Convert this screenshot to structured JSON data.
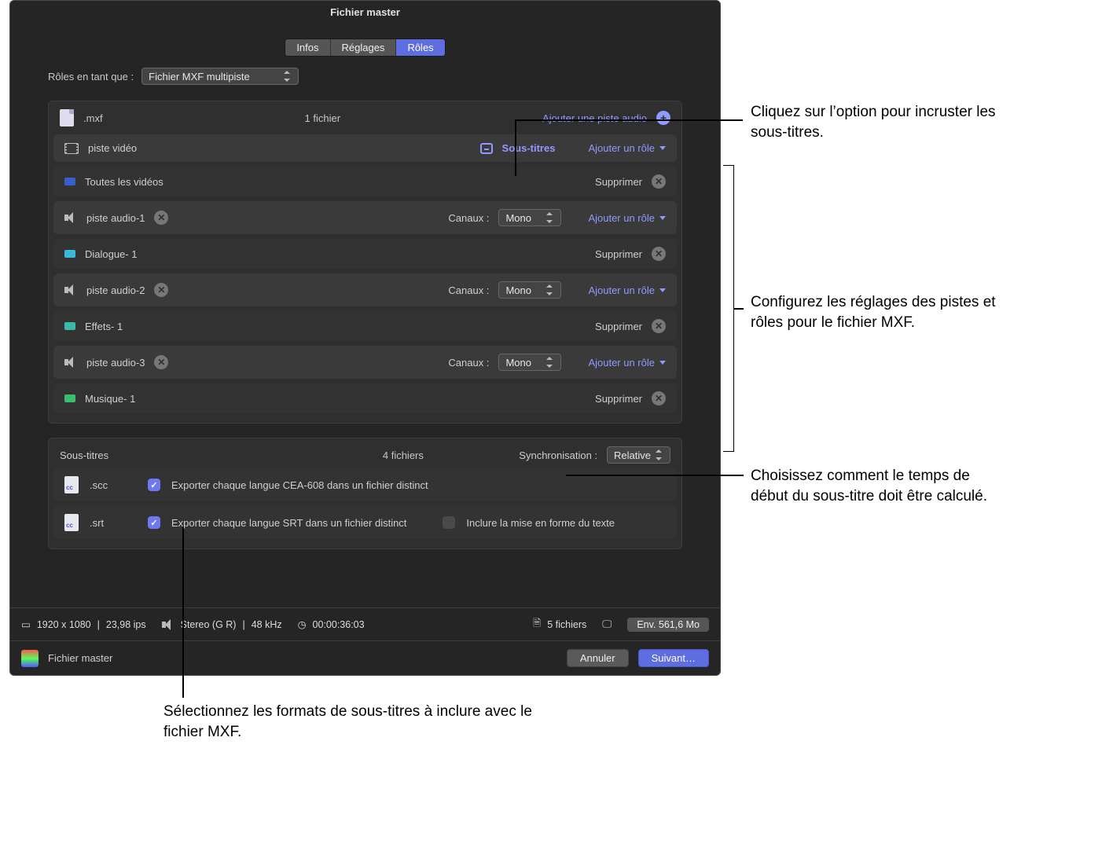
{
  "window_title": "Fichier master",
  "tabs": {
    "infos": "Infos",
    "reglages": "Réglages",
    "roles": "Rôles"
  },
  "roles_as": {
    "label": "Rôles en tant que :",
    "value": "Fichier MXF multipiste"
  },
  "mxf": {
    "ext": ".mxf",
    "count": "1 fichier",
    "add_audio": "Ajouter une piste audio",
    "video_track": {
      "label": "piste vidéo",
      "captions_btn": "Sous-titres",
      "add_role": "Ajouter un rôle",
      "sub": {
        "label": "Toutes les vidéos",
        "remove": "Supprimer"
      }
    },
    "channels_label": "Canaux :",
    "add_role": "Ajouter un rôle",
    "remove": "Supprimer",
    "audio": [
      {
        "name": "piste audio-1",
        "channel": "Mono",
        "sub": "Dialogue- 1",
        "chip": "cyan"
      },
      {
        "name": "piste audio-2",
        "channel": "Mono",
        "sub": "Effets- 1",
        "chip": "teal"
      },
      {
        "name": "piste audio-3",
        "channel": "Mono",
        "sub": "Musique- 1",
        "chip": "green"
      }
    ]
  },
  "captions": {
    "header": "Sous-titres",
    "count": "4 fichiers",
    "sync_label": "Synchronisation :",
    "sync_value": "Relative",
    "rows": [
      {
        "ext": ".scc",
        "export_label": "Exporter chaque langue CEA-608 dans un fichier distinct",
        "include_fmt": null
      },
      {
        "ext": ".srt",
        "export_label": "Exporter chaque langue SRT dans un fichier distinct",
        "include_fmt": "Inclure la mise en forme du texte"
      }
    ]
  },
  "status": {
    "resolution": "1920 x 1080",
    "fps": "23,98 ips",
    "audio": "Stereo (G R)",
    "khz": "48 kHz",
    "duration": "00:00:36:03",
    "files": "5 fichiers",
    "size": "Env. 561,6 Mo"
  },
  "footer": {
    "master": "Fichier master",
    "cancel": "Annuler",
    "next": "Suivant…"
  },
  "callouts": {
    "burn": "Cliquez sur l’option pour incruster les sous-titres.",
    "tracks": "Configurez les réglages des pistes et rôles pour le fichier MXF.",
    "sync": "Choisissez comment le temps de début du sous-titre doit être calculé.",
    "formats": "Sélectionnez les formats de sous-titres à inclure avec le fichier MXF."
  }
}
